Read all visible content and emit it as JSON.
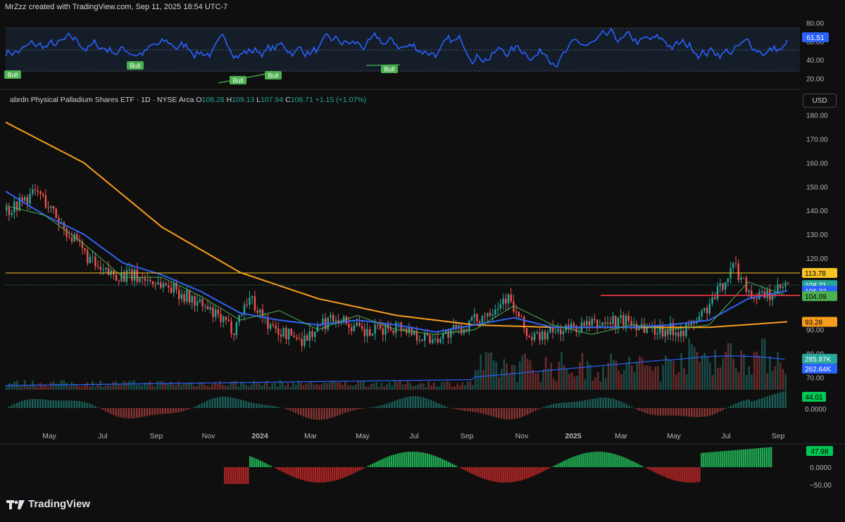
{
  "header": {
    "created_by": "MrZzz created with TradingView.com, Sep 11, 2025 18:54 UTC-7"
  },
  "legend": {
    "symbol": "abrdn Physical Palladium Shares ETF · 1D · NYSE Arca",
    "open_label": "O",
    "open": "108.28",
    "high_label": "H",
    "high": "109.13",
    "low_label": "L",
    "low": "107.94",
    "close_label": "C",
    "close": "108.71",
    "change": "+1.15 (+1.07%)"
  },
  "currency_button": "USD",
  "brand": {
    "name": "TradingView"
  },
  "colors": {
    "up": "#26a69a",
    "down": "#ef5350",
    "rsi": "#2962ff",
    "ma_long": "#f89d1c",
    "ma_mid": "#2f62f1",
    "ma_short": "#4caf50",
    "resistance": "#f7c325",
    "support": "#f23645"
  },
  "chart_data": [
    {
      "type": "line",
      "name": "rsi-pane",
      "yticks": [
        "80.00",
        "60.00",
        "40.00",
        "20.00"
      ],
      "ylim": [
        15,
        85
      ],
      "bands": [
        70,
        30
      ],
      "midline": 50,
      "last_value": "61.51",
      "divergence_labels": [
        "Bull",
        "Bull",
        "Bull",
        "Bull",
        "Bull"
      ],
      "grid": false
    },
    {
      "type": "line",
      "name": "price-pane",
      "x_ticks": [
        "May",
        "Jul",
        "Sep",
        "Nov",
        "2024",
        "Mar",
        "May",
        "Jul",
        "Sep",
        "Nov",
        "2025",
        "Mar",
        "May",
        "Jul",
        "Sep"
      ],
      "yticks": [
        "180.00",
        "170.00",
        "160.00",
        "150.00",
        "140.00",
        "130.00",
        "120.00",
        "110.00",
        "90.00",
        "80.00",
        "70.00"
      ],
      "ylim": [
        66,
        184
      ],
      "price_close_approx": {
        "x": [
          0,
          0.04,
          0.08,
          0.12,
          0.17,
          0.21,
          0.25,
          0.29,
          0.31,
          0.34,
          0.38,
          0.42,
          0.46,
          0.5,
          0.54,
          0.58,
          0.61,
          0.64,
          0.67,
          0.71,
          0.75,
          0.79,
          0.83,
          0.87,
          0.9,
          0.93,
          0.955,
          0.975,
          1.0
        ],
        "y": [
          140,
          148,
          130,
          114,
          112,
          108,
          100,
          90,
          104,
          90,
          86,
          96,
          88,
          92,
          86,
          90,
          96,
          104,
          86,
          90,
          92,
          94,
          90,
          90,
          100,
          117,
          104,
          104,
          108.7
        ]
      },
      "ma_long": {
        "x": [
          0,
          0.1,
          0.2,
          0.3,
          0.4,
          0.5,
          0.6,
          0.7,
          0.8,
          0.9,
          1.0
        ],
        "y": [
          177,
          160,
          133,
          114,
          103,
          96,
          92,
          91,
          91,
          91,
          93.3
        ]
      },
      "ma_mid": {
        "x": [
          0,
          0.05,
          0.1,
          0.15,
          0.2,
          0.25,
          0.3,
          0.35,
          0.4,
          0.45,
          0.5,
          0.55,
          0.6,
          0.65,
          0.7,
          0.75,
          0.8,
          0.85,
          0.9,
          0.95,
          1.0
        ],
        "y": [
          148,
          138,
          130,
          118,
          113,
          106,
          97,
          94,
          92,
          94,
          92,
          89,
          92,
          95,
          91,
          91,
          91,
          92,
          94,
          103,
          106.3
        ]
      },
      "ma_short": {
        "x": [
          0,
          0.05,
          0.1,
          0.15,
          0.2,
          0.25,
          0.3,
          0.35,
          0.4,
          0.45,
          0.5,
          0.55,
          0.6,
          0.65,
          0.7,
          0.75,
          0.8,
          0.85,
          0.9,
          0.95,
          1.0
        ],
        "y": [
          142,
          138,
          126,
          112,
          112,
          104,
          94,
          98,
          90,
          96,
          90,
          88,
          90,
          100,
          92,
          88,
          92,
          90,
          92,
          110,
          104.1
        ]
      },
      "resistance": 113.78,
      "support": 104.4,
      "price_labels": [
        "113.78",
        "108.71",
        "106.32",
        "104.09",
        "93.28",
        "285.87K",
        "262.64K"
      ],
      "grid": false
    },
    {
      "type": "bar",
      "name": "momentum-pane",
      "yticks": [
        "0.0000"
      ],
      "last_value": "44.01"
    },
    {
      "type": "bar",
      "name": "oscillator-pane",
      "yticks": [
        "0.0000",
        "−50.00"
      ],
      "last_value": "47.98"
    }
  ]
}
